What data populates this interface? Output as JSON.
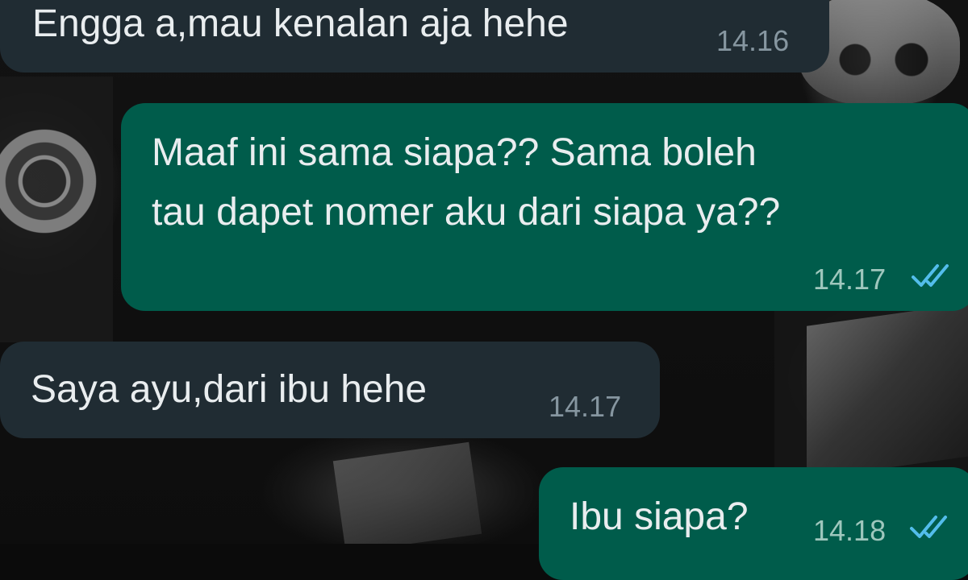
{
  "colors": {
    "incoming_bubble": "#202c33",
    "outgoing_bubble": "#005c4b",
    "message_text": "#e9edef",
    "timestamp": "#8696a0",
    "read_ticks": "#53bdeb"
  },
  "messages": [
    {
      "direction": "incoming",
      "text": "Engga a,mau kenalan aja hehe",
      "time": "14.16"
    },
    {
      "direction": "outgoing",
      "lines": [
        "Maaf ini sama siapa?? Sama boleh",
        "tau dapet nomer aku dari siapa ya??"
      ],
      "time": "14.17",
      "status": "read",
      "status_icon": "double-check-icon"
    },
    {
      "direction": "incoming",
      "text": "Saya ayu,dari ibu hehe",
      "time": "14.17"
    },
    {
      "direction": "outgoing",
      "text": "Ibu siapa?",
      "time": "14.18",
      "status": "read",
      "status_icon": "double-check-icon"
    }
  ]
}
